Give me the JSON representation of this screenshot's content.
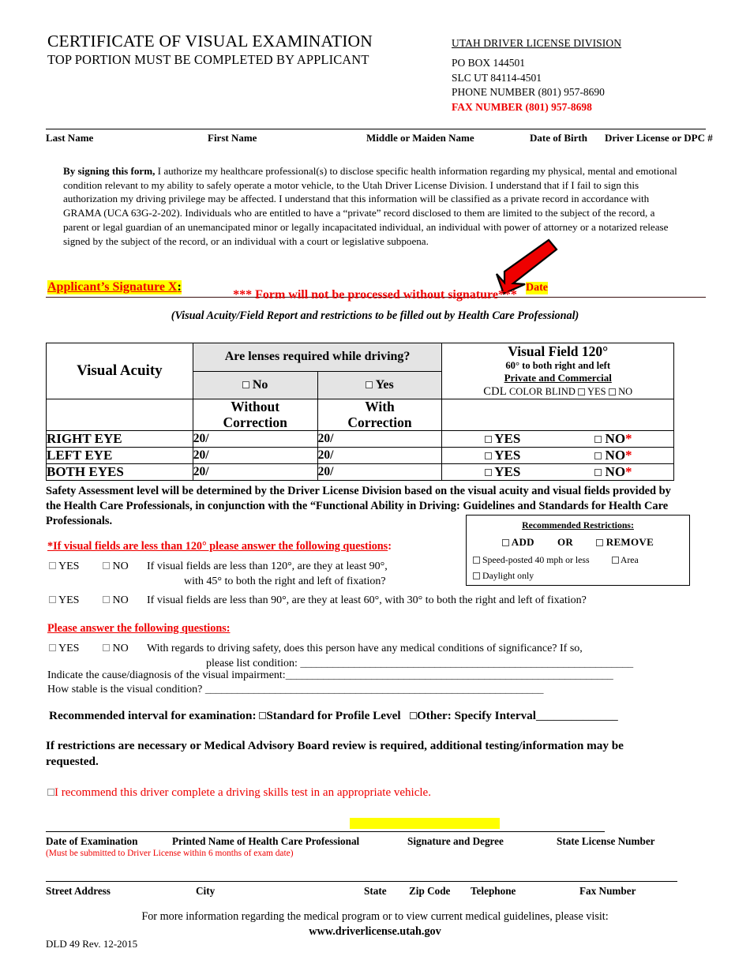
{
  "header": {
    "title_line1": "CERTIFICATE OF VISUAL EXAMINATION",
    "title_line2": "TOP PORTION MUST BE COMPLETED BY APPLICANT",
    "agency": "UTAH DRIVER LICENSE DIVISION",
    "po_box": "PO BOX 144501",
    "city_state_zip": "SLC UT   84114-4501",
    "phone": "PHONE NUMBER (801) 957-8690",
    "fax": "FAX NUMBER (801) 957-8698"
  },
  "name_fields": [
    {
      "label": "Last Name"
    },
    {
      "label": "First Name"
    },
    {
      "label": "Middle or Maiden Name"
    },
    {
      "label": "Date of Birth"
    },
    {
      "label": "Driver License or DPC #"
    }
  ],
  "consent": {
    "lead": "By signing this form,",
    "body": " I authorize my healthcare professional(s) to disclose specific health information regarding my physical, mental and emotional condition relevant to my ability to safely operate a motor vehicle, to the Utah Driver License Division.  I understand that if I fail to sign this authorization my driving privilege may be affected.  I understand that this information will be classified as a private record in accordance with GRAMA (UCA 63G-2-202).   Individuals who are entitled to have a “private” record disclosed to them are limited to the subject of the record, a parent or legal guardian of an unemancipated minor or legally incapacitated individual, an individual with power of attorney or a notarized release signed by the subject of the record, or an individual with a court or legislative subpoena."
  },
  "signature": {
    "applicant_label": "Applicant’s Signature X",
    "colon": ":",
    "date_label": "Date",
    "warning": "*** Form will not be processed without signature***"
  },
  "table": {
    "caption": "(Visual Acuity/Field Report and restrictions to be filled out by Health Care Professional)",
    "acuity_header": "Visual Acuity",
    "lens_question": "Are lenses required while driving?",
    "lens_no": "No",
    "lens_yes": "Yes",
    "without_correction_l1": "Without",
    "without_correction_l2": "Correction",
    "with_correction_l1": "With",
    "with_correction_l2": "Correction",
    "visual_field_title": "Visual Field 120°",
    "visual_field_sub1": "60° to both right and left",
    "visual_field_sub2": "Private and Commercial",
    "cdl_prefix": "CDL",
    "cdl_text": "COLOR BLIND",
    "cdl_yes": "YES",
    "cdl_no": "NO",
    "rows": [
      {
        "label": "RIGHT EYE",
        "without": "20/",
        "with": "20/",
        "yes": "YES",
        "no": "NO",
        "asterisk": "*"
      },
      {
        "label": "LEFT EYE",
        "without": "20/",
        "with": "20/",
        "yes": "YES",
        "no": "NO",
        "asterisk": "*"
      },
      {
        "label": "BOTH EYES",
        "without": "20/",
        "with": "20/",
        "yes": "YES",
        "no": "NO",
        "asterisk": "*"
      }
    ]
  },
  "safety": {
    "text": "Safety Assessment level will be determined by the Driver License Division based on the visual acuity and visual fields provided by the Health Care Professionals, in conjunction with the “Functional Ability in Driving:  Guidelines and Standards for Health Care Professionals."
  },
  "restrictions_box": {
    "title": "Recommended Restrictions:",
    "add": "ADD",
    "or": "OR",
    "remove": "REMOVE",
    "speed": "Speed-posted 40 mph or less",
    "area": "Area",
    "daylight": "Daylight only"
  },
  "fields_section": {
    "heading": "*If visual fields are less than 120° please answer the following questions",
    "heading_colon": ":",
    "yes": "YES",
    "no": "NO",
    "q1_line1": "If visual fields are less than 120°, are they at least 90°,",
    "q1_line2": "with 45° to both the right and left of fixation?",
    "q2": "If visual fields are less than 90°, are they at least 60°, with 30° to both the right and left of fixation?"
  },
  "please_section": {
    "heading": "Please answer the following questions:",
    "yes": "YES",
    "no": "NO",
    "q1_line1": "With regards to driving safety, does this person have any medical conditions of significance?  If so,",
    "q1_line2": "please list condition:",
    "cause_label": "Indicate the cause/diagnosis of the visual impairment:",
    "stable_label": "How stable is the visual condition?"
  },
  "interval": {
    "label": "Recommended interval for examination:",
    "standard": "Standard for Profile Level",
    "other": "Other: Specify Interval"
  },
  "restrict_note": {
    "text": "If restrictions are necessary or Medical Advisory Board review is required, additional testing/information may be requested."
  },
  "skills_test": {
    "text": "I recommend this driver complete a driving skills test in an appropriate vehicle."
  },
  "footer_block1": [
    {
      "label": "Date of Examination"
    },
    {
      "label": "Printed Name of Health Care Professional"
    },
    {
      "label": "Signature and Degree"
    },
    {
      "label": "State License Number"
    }
  ],
  "footer_note": "(Must be submitted to Driver License within 6 months of exam date)",
  "footer_block2": [
    {
      "label": "Street Address"
    },
    {
      "label": "City"
    },
    {
      "label": "State"
    },
    {
      "label": "Zip Code"
    },
    {
      "label": "Telephone"
    },
    {
      "label": "Fax Number"
    }
  ],
  "footer": {
    "more_info": "For more information regarding the medical program or to view current medical guidelines, please visit:",
    "website": "www.driverlicense.utah.gov",
    "form_id": "DLD 49 Rev. 12-2015"
  },
  "colors": {
    "red": "#ee0000",
    "highlight": "#ffff00",
    "table_header_gray": "#e4e4e4"
  }
}
